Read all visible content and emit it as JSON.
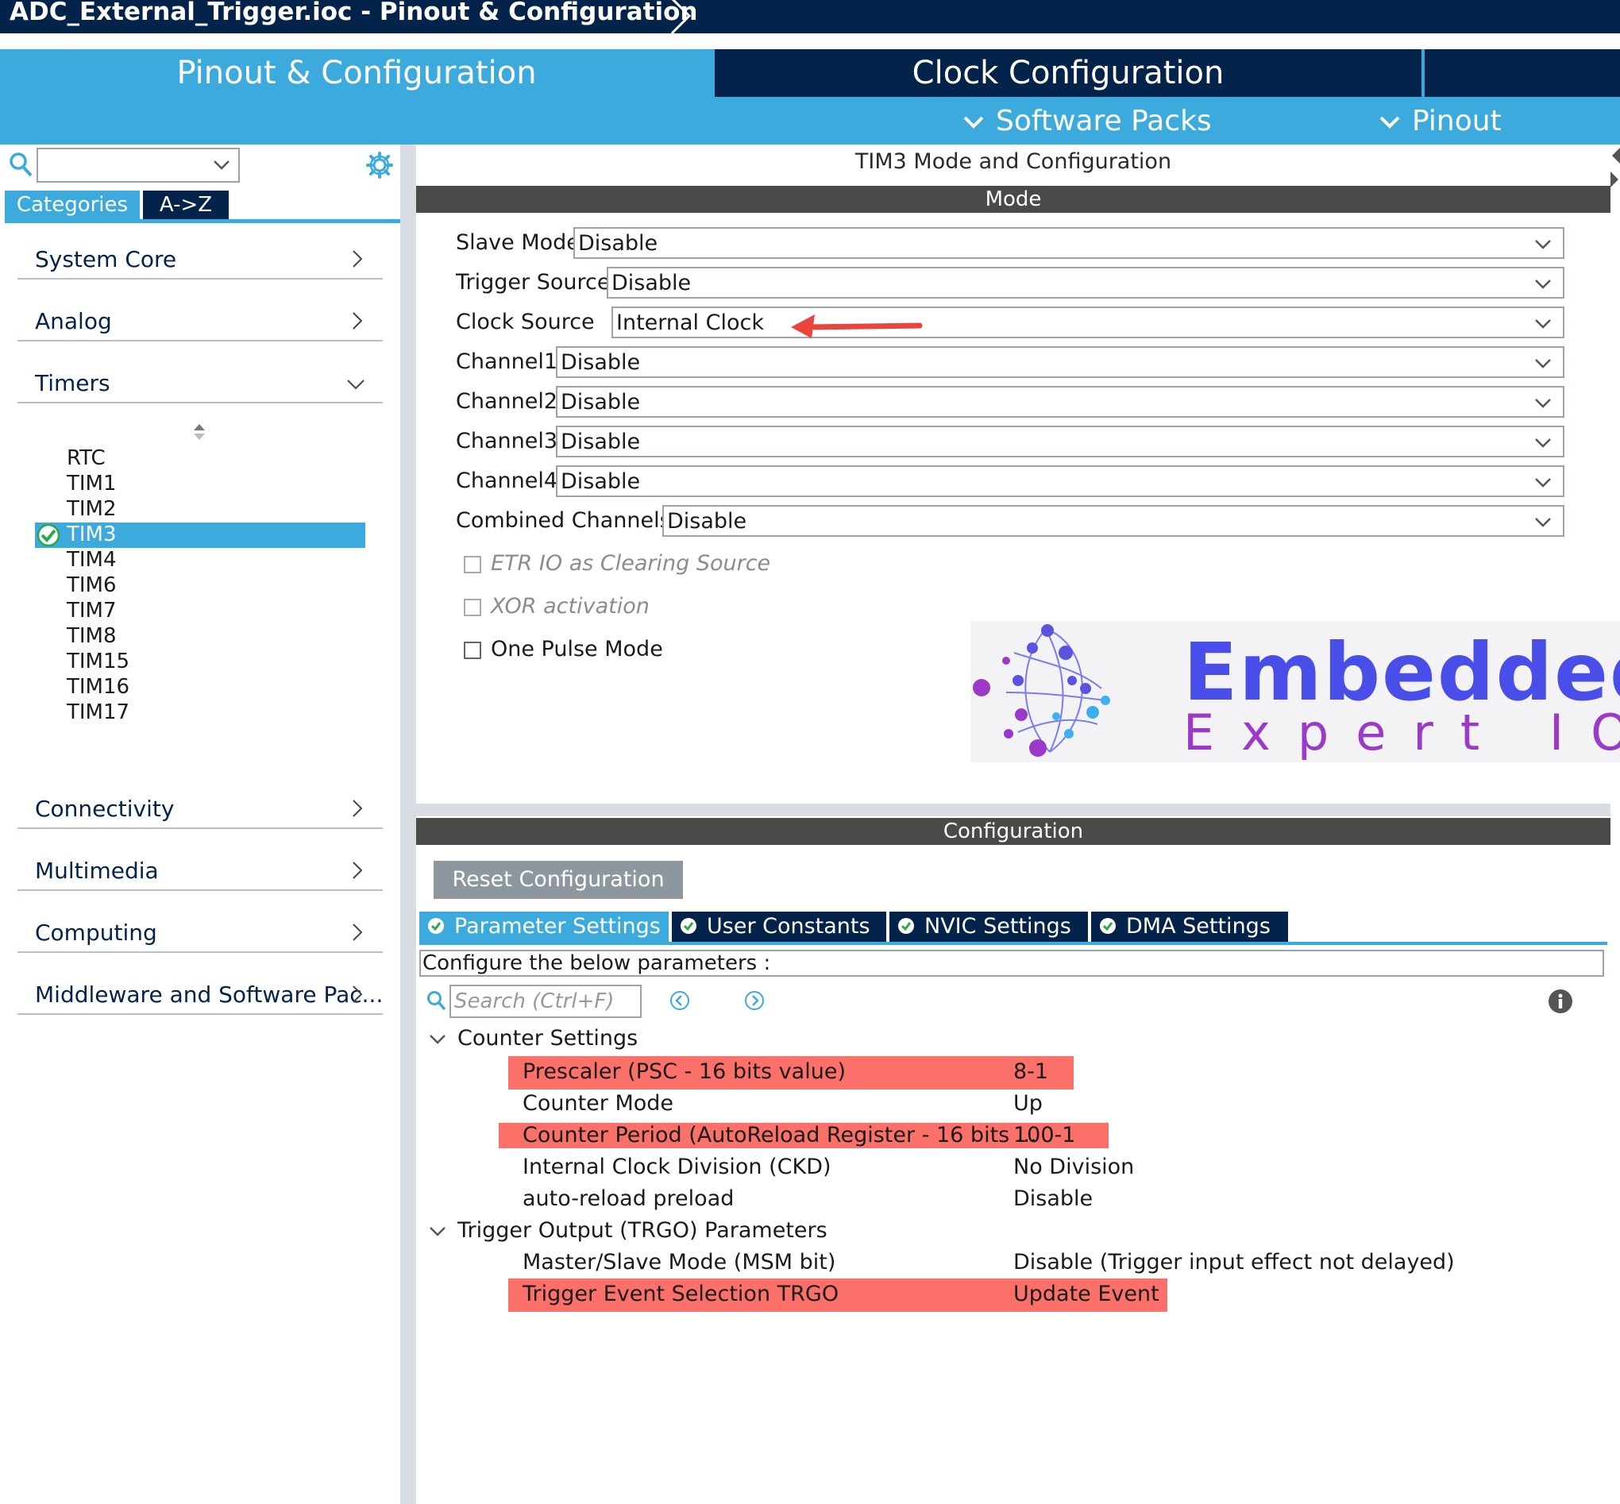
{
  "window": {
    "title": "ADC_External_Trigger.ioc - Pinout & Configuration"
  },
  "main_tabs": {
    "pinout": "Pinout & Configuration",
    "clock": "Clock Configuration"
  },
  "menus": {
    "software_packs": "Software Packs",
    "pinout": "Pinout"
  },
  "sidebar": {
    "search_value": "",
    "tabs": [
      "Categories",
      "A->Z"
    ],
    "categories": [
      {
        "label": "System Core",
        "expanded": false
      },
      {
        "label": "Analog",
        "expanded": false
      },
      {
        "label": "Timers",
        "expanded": true
      },
      {
        "label": "Connectivity",
        "expanded": false
      },
      {
        "label": "Multimedia",
        "expanded": false
      },
      {
        "label": "Computing",
        "expanded": false
      },
      {
        "label": "Middleware and Software Pac...",
        "expanded": false
      }
    ],
    "timers": [
      "RTC",
      "TIM1",
      "TIM2",
      "TIM3",
      "TIM4",
      "TIM6",
      "TIM7",
      "TIM8",
      "TIM15",
      "TIM16",
      "TIM17"
    ],
    "selected_timer": "TIM3"
  },
  "panel": {
    "title": "TIM3 Mode and Configuration",
    "mode_header": "Mode",
    "mode_fields": [
      {
        "label": "Slave Mode",
        "value": "Disable"
      },
      {
        "label": "Trigger Source",
        "value": "Disable"
      },
      {
        "label": "Clock Source",
        "value": "Internal Clock"
      },
      {
        "label": "Channel1",
        "value": "Disable"
      },
      {
        "label": "Channel2",
        "value": "Disable"
      },
      {
        "label": "Channel3",
        "value": "Disable"
      },
      {
        "label": "Channel4",
        "value": "Disable"
      },
      {
        "label": "Combined Channels",
        "value": "Disable"
      }
    ],
    "checkboxes": [
      {
        "label": "ETR IO as Clearing Source",
        "checked": false,
        "enabled": false
      },
      {
        "label": "XOR activation",
        "checked": false,
        "enabled": false
      },
      {
        "label": "One Pulse Mode",
        "checked": false,
        "enabled": true
      }
    ],
    "logo": {
      "line1": "Embedded",
      "line2": "Expert IO"
    },
    "config_header": "Configuration",
    "reset_button": "Reset Configuration",
    "config_tabs": [
      "Parameter Settings",
      "User Constants",
      "NVIC Settings",
      "DMA Settings"
    ],
    "configure_text": "Configure the below parameters :",
    "search_placeholder": "Search (Ctrl+F)",
    "groups": [
      {
        "name": "Counter Settings",
        "params": [
          {
            "name": "Prescaler (PSC - 16 bits value)",
            "value": "8-1",
            "highlighted": true
          },
          {
            "name": "Counter Mode",
            "value": "Up",
            "highlighted": false
          },
          {
            "name": "Counter Period (AutoReload Register - 16 bits ...",
            "value": "100-1",
            "highlighted": true
          },
          {
            "name": "Internal Clock Division (CKD)",
            "value": "No Division",
            "highlighted": false
          },
          {
            "name": "auto-reload preload",
            "value": "Disable",
            "highlighted": false
          }
        ]
      },
      {
        "name": "Trigger Output (TRGO) Parameters",
        "params": [
          {
            "name": "Master/Slave Mode (MSM bit)",
            "value": "Disable (Trigger input effect not delayed)",
            "highlighted": false
          },
          {
            "name": "Trigger Event Selection TRGO",
            "value": "Update Event",
            "highlighted": true
          }
        ]
      }
    ]
  },
  "colors": {
    "navy": "#03234b",
    "accent_blue": "#3caadc",
    "highlight_red": "#fc706a",
    "header_gray": "#4a4a4a"
  }
}
